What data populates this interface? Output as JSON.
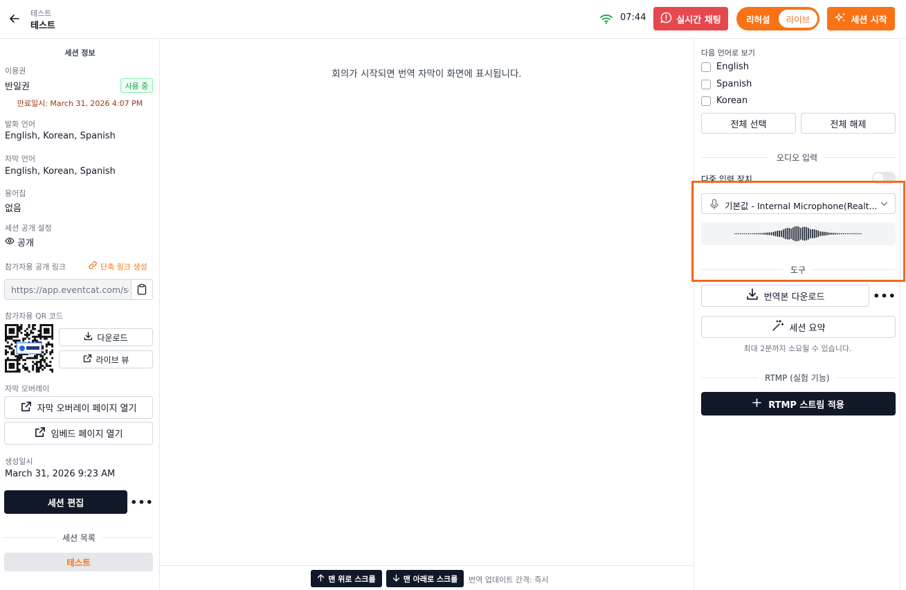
{
  "header": {
    "breadcrumb": "테스트",
    "title": "테스트",
    "clock": "07:44",
    "chat_button": "실시간 채팅",
    "mode_rehearsal": "리허설",
    "mode_live": "라이브",
    "start_button": "세션 시작"
  },
  "left": {
    "title": "세션 정보",
    "license_label": "이용권",
    "license_value": "반일권",
    "license_badge": "사용 중",
    "expiry": "만료일시: March 31, 2026 4:07 PM",
    "speech_lang_label": "발화 언어",
    "speech_lang_value": "English, Korean, Spanish",
    "subtitle_lang_label": "자막 언어",
    "subtitle_lang_value": "English, Korean, Spanish",
    "glossary_label": "용어집",
    "glossary_value": "없음",
    "visibility_label": "세션 공개 설정",
    "visibility_value": "공개",
    "public_link_label": "참가자용 공개 링크",
    "short_link_button": "단축 링크 생성",
    "public_link_url": "https://app.eventcat.com/se",
    "qr_label": "참가자용 QR 코드",
    "download_button": "다운로드",
    "live_view_button": "라이브 뷰",
    "overlay_label": "자막 오버레이",
    "overlay_button": "자막 오버레이 페이지 열기",
    "embed_button": "임베드 페이지 열기",
    "created_label": "생성일시",
    "created_value": "March 31, 2026 9:23 AM",
    "edit_button": "세션 편집",
    "more_button": "•••",
    "session_list_label": "세션 목록",
    "session_items": [
      "테스트"
    ]
  },
  "center": {
    "placeholder": "회의가 시작되면 번역 자막이 화면에 표시됩니다.",
    "scroll_top_button": "맨 위로 스크롤",
    "scroll_bottom_button": "맨 아래로 스크롤",
    "update_interval": "번역 업데이트 간격: 즉시"
  },
  "right": {
    "view_in_label": "다음 언어로 보기",
    "languages": [
      "English",
      "Spanish",
      "Korean"
    ],
    "select_all_button": "전체 선택",
    "deselect_all_button": "전체 해제",
    "audio_input_label": "오디오 입력",
    "multi_input_label": "다중 입력 장치",
    "mic_device": "기본값 - Internal Microphone(Realt...",
    "tools_label": "도구",
    "download_translation_button": "번역본 다운로드",
    "more_button": "•••",
    "summary_button": "세션 요약",
    "summary_note": "최대 2분까지 소요될 수 있습니다.",
    "rtmp_label": "RTMP (실험 기능)",
    "rtmp_button": "RTMP 스트림 적용"
  },
  "colors": {
    "accent": "#f97316",
    "danger": "#e5484d",
    "dark": "#111827",
    "wifi": "#16a34a",
    "highlight": "#f26a1b"
  }
}
